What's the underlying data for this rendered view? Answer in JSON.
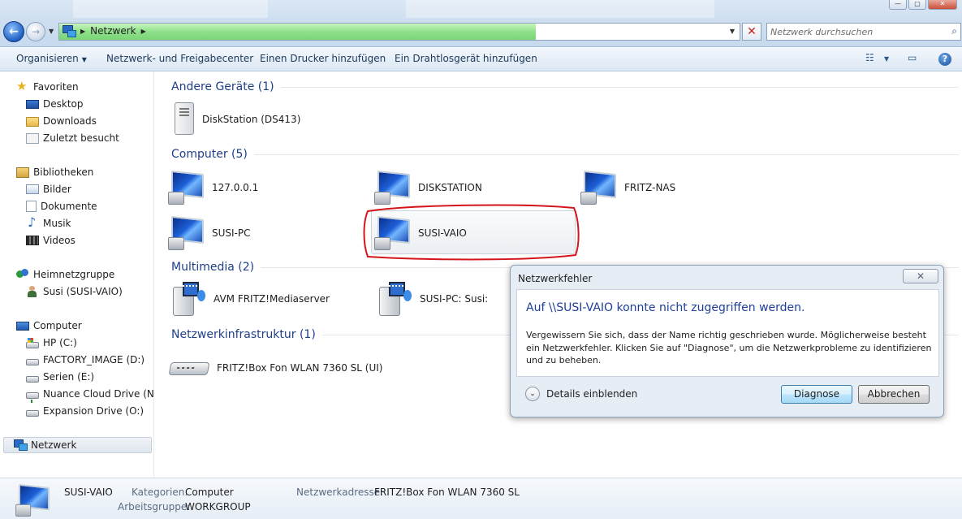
{
  "address_bar": {
    "path": "Netzwerk",
    "progress": 0.7
  },
  "search": {
    "placeholder": "Netzwerk durchsuchen"
  },
  "toolbar": {
    "organize": "Organisieren",
    "network_sharing_center": "Netzwerk- und Freigabecenter",
    "add_printer": "Einen Drucker hinzufügen",
    "add_wireless": "Ein Drahtlosgerät hinzufügen"
  },
  "sidebar": {
    "favorites": {
      "label": "Favoriten",
      "items": [
        "Desktop",
        "Downloads",
        "Zuletzt besucht"
      ]
    },
    "libraries": {
      "label": "Bibliotheken",
      "items": [
        "Bilder",
        "Dokumente",
        "Musik",
        "Videos"
      ]
    },
    "homegroup": {
      "label": "Heimnetzgruppe",
      "items": [
        "Susi (SUSI-VAIO)"
      ]
    },
    "computer": {
      "label": "Computer",
      "items": [
        "HP (C:)",
        "FACTORY_IMAGE (D:)",
        "Serien (E:)",
        "Nuance Cloud Drive (N:)",
        "Expansion Drive (O:)"
      ]
    },
    "network": {
      "label": "Netzwerk"
    }
  },
  "categories": {
    "other_devices": {
      "title": "Andere Geräte (1)",
      "items": [
        "DiskStation (DS413)"
      ]
    },
    "computers": {
      "title": "Computer (5)",
      "items": [
        "127.0.0.1",
        "DISKSTATION",
        "FRITZ-NAS",
        "SUSI-PC",
        "SUSI-VAIO"
      ]
    },
    "multimedia": {
      "title": "Multimedia (2)",
      "items": [
        "AVM FRITZ!Mediaserver",
        "SUSI-PC: Susi:"
      ]
    },
    "infrastructure": {
      "title": "Netzwerkinfrastruktur (1)",
      "items": [
        "FRITZ!Box Fon WLAN 7360 SL (UI)"
      ]
    }
  },
  "dialog": {
    "title": "Netzwerkfehler",
    "heading": "Auf \\\\SUSI-VAIO konnte nicht zugegriffen werden.",
    "message": "Vergewissern Sie sich, dass der Name richtig geschrieben wurde. Möglicherweise besteht ein Netzwerkfehler. Klicken Sie auf \"Diagnose\", um die Netzwerkprobleme zu identifizieren und zu beheben.",
    "details_toggle": "Details einblenden",
    "diagnose": "Diagnose",
    "cancel": "Abbrechen",
    "close_glyph": "✕"
  },
  "details_pane": {
    "name": "SUSI-VAIO",
    "category_label": "Kategorien:",
    "category_value": "Computer",
    "workgroup_label": "Arbeitsgruppe:",
    "workgroup_value": "WORKGROUP",
    "address_label": "Netzwerkadresse:",
    "address_value": "FRITZ!Box Fon WLAN 7360 SL"
  },
  "colors": {
    "accent_text": "#1e3f88",
    "highlight_ring": "#d4161c",
    "progress_green": "#8fe08a"
  }
}
